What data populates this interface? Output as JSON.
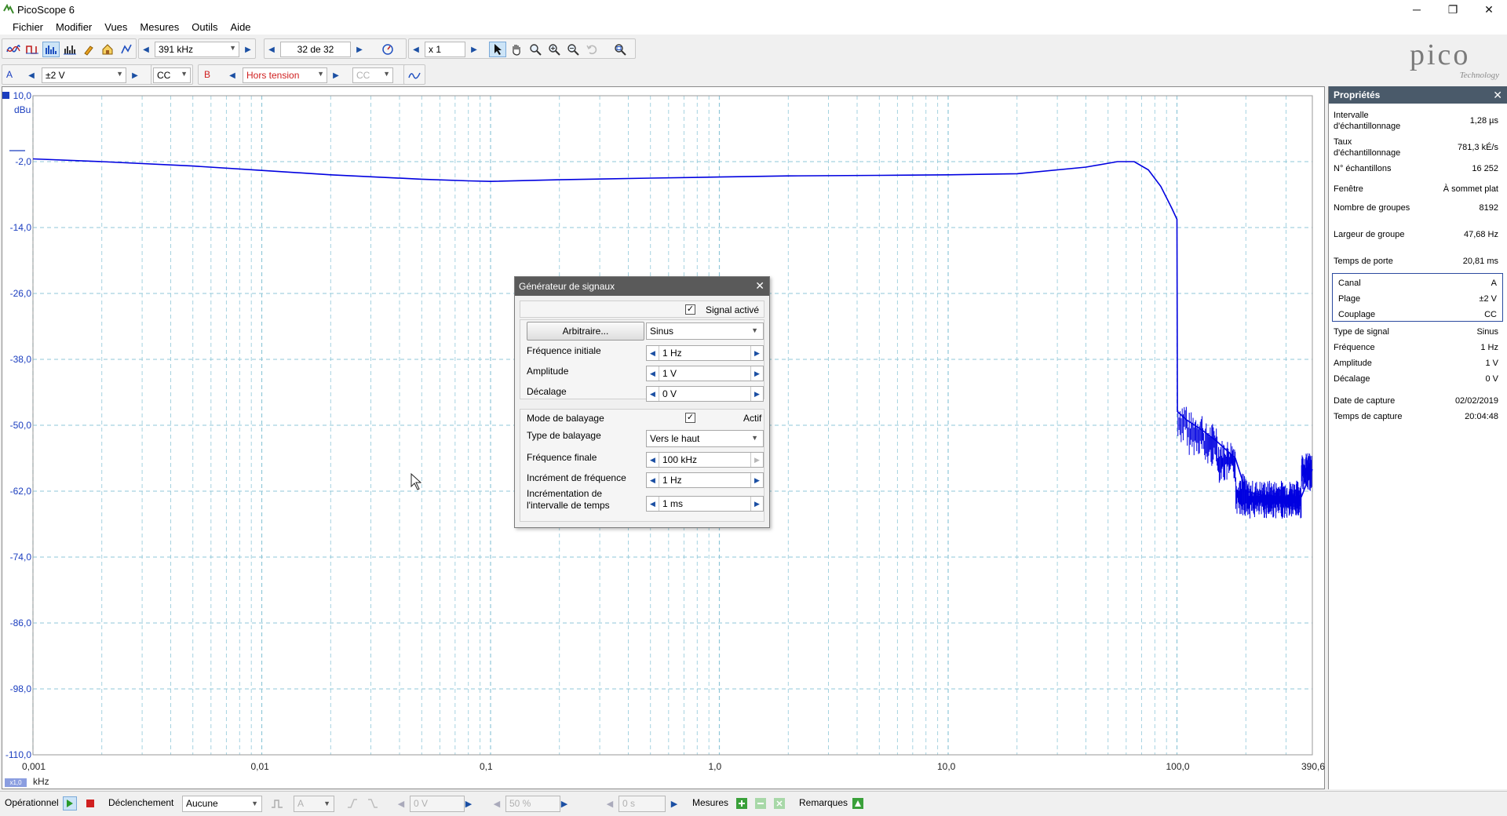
{
  "window": {
    "title": "PicoScope 6",
    "controls": [
      "─",
      "❐",
      "✕"
    ]
  },
  "menu": [
    "Fichier",
    "Modifier",
    "Vues",
    "Mesures",
    "Outils",
    "Aide"
  ],
  "toolbar": {
    "frequency": "391 kHz",
    "buffer": "32 de 32",
    "zoom": "x 1"
  },
  "channels": {
    "a": {
      "letter": "A",
      "range": "±2 V",
      "coupling": "CC"
    },
    "b": {
      "letter": "B",
      "range": "Hors tension",
      "coupling": "CC"
    }
  },
  "logo": {
    "text": "pico",
    "sub": "Technology"
  },
  "plot": {
    "y_unit": "dBu",
    "x_unit": "kHz",
    "x_scale_tag": "x1,0",
    "y_ticks": [
      "10,0",
      "-2,0",
      "-14,0",
      "-26,0",
      "-38,0",
      "-50,0",
      "-62,0",
      "-74,0",
      "-86,0",
      "-98,0",
      "-110,0"
    ],
    "x_ticks": [
      "0,001",
      "0,01",
      "0,1",
      "1,0",
      "10,0",
      "100,0",
      "390,6"
    ],
    "trace_color": "#0000e0",
    "grid_color": "#8fc7d8"
  },
  "chart_data": {
    "type": "line",
    "title": "",
    "xlabel": "kHz",
    "ylabel": "dBu",
    "x_scale": "log",
    "xlim": [
      0.001,
      390.6
    ],
    "ylim": [
      -110,
      10
    ],
    "grid": true,
    "series": [
      {
        "x": [
          0.001,
          0.002,
          0.005,
          0.01,
          0.02,
          0.05,
          0.08,
          0.1,
          0.2,
          0.5,
          1.0,
          2.0,
          5.0,
          10.0,
          20.0,
          40.0,
          55.0,
          65.0,
          75.0,
          85.0,
          95.0,
          100.0,
          100.5,
          110.0,
          130.0,
          150.0,
          180.0,
          200.0,
          250.0,
          300.0,
          350.0,
          390.6
        ],
        "y": [
          -1.5,
          -2.0,
          -2.8,
          -3.6,
          -4.4,
          -5.2,
          -5.5,
          -5.6,
          -5.3,
          -5.0,
          -4.8,
          -4.6,
          -4.5,
          -4.4,
          -4.2,
          -3.0,
          -2.0,
          -2.0,
          -3.5,
          -6.5,
          -10.5,
          -12.5,
          -47.5,
          -49.0,
          -51.0,
          -53.0,
          -56.0,
          -62.0,
          -63.0,
          -63.0,
          -63.0,
          -58.0
        ]
      }
    ]
  },
  "signal_generator": {
    "title": "Générateur de signaux",
    "signal_active_label": "Signal activé",
    "arbitrary_button": "Arbitraire...",
    "waveform": "Sinus",
    "start_frequency_label": "Fréquence initiale",
    "start_frequency": "1 Hz",
    "amplitude_label": "Amplitude",
    "amplitude": "1 V",
    "offset_label": "Décalage",
    "offset": "0 V",
    "sweep_mode_label": "Mode de balayage",
    "sweep_active_label": "Actif",
    "sweep_type_label": "Type de balayage",
    "sweep_type": "Vers le haut",
    "stop_frequency_label": "Fréquence finale",
    "stop_frequency": "100 kHz",
    "freq_increment_label": "Incrément de fréquence",
    "freq_increment": "1 Hz",
    "time_increment_label_1": "Incrémentation de",
    "time_increment_label_2": "l'intervalle de temps",
    "time_increment": "1 ms"
  },
  "properties": {
    "title": "Propriétés",
    "rows": [
      {
        "label": "Intervalle d'échantillonnage",
        "value": "1,28 µs"
      },
      {
        "label": "Taux d'échantillonnage",
        "value": "781,3 kÉ/s"
      },
      {
        "label": "N° échantillons",
        "value": "16 252"
      },
      {
        "label": "Fenêtre",
        "value": "À sommet plat"
      },
      {
        "label": "Nombre de groupes",
        "value": "8192"
      },
      {
        "label": "Largeur de groupe",
        "value": "47,68 Hz"
      },
      {
        "label": "Temps de porte",
        "value": "20,81 ms"
      },
      {
        "label": "Canal",
        "value": "A"
      },
      {
        "label": "Plage",
        "value": "±2 V"
      },
      {
        "label": "Couplage",
        "value": "CC"
      },
      {
        "label": "Type de signal",
        "value": "Sinus"
      },
      {
        "label": "Fréquence",
        "value": "1 Hz"
      },
      {
        "label": "Amplitude",
        "value": "1 V"
      },
      {
        "label": "Décalage",
        "value": "0 V"
      },
      {
        "label": "Date de capture",
        "value": "02/02/2019"
      },
      {
        "label": "Temps de capture",
        "value": "20:04:48"
      }
    ]
  },
  "statusbar": {
    "run_label": "Opérationnel",
    "trigger_label": "Déclenchement",
    "trigger_mode": "Aucune",
    "trigger_source": "A",
    "threshold": "0 V",
    "pretrigger": "50 %",
    "delay": "0 s",
    "measurements_label": "Mesures",
    "notes_label": "Remarques"
  }
}
